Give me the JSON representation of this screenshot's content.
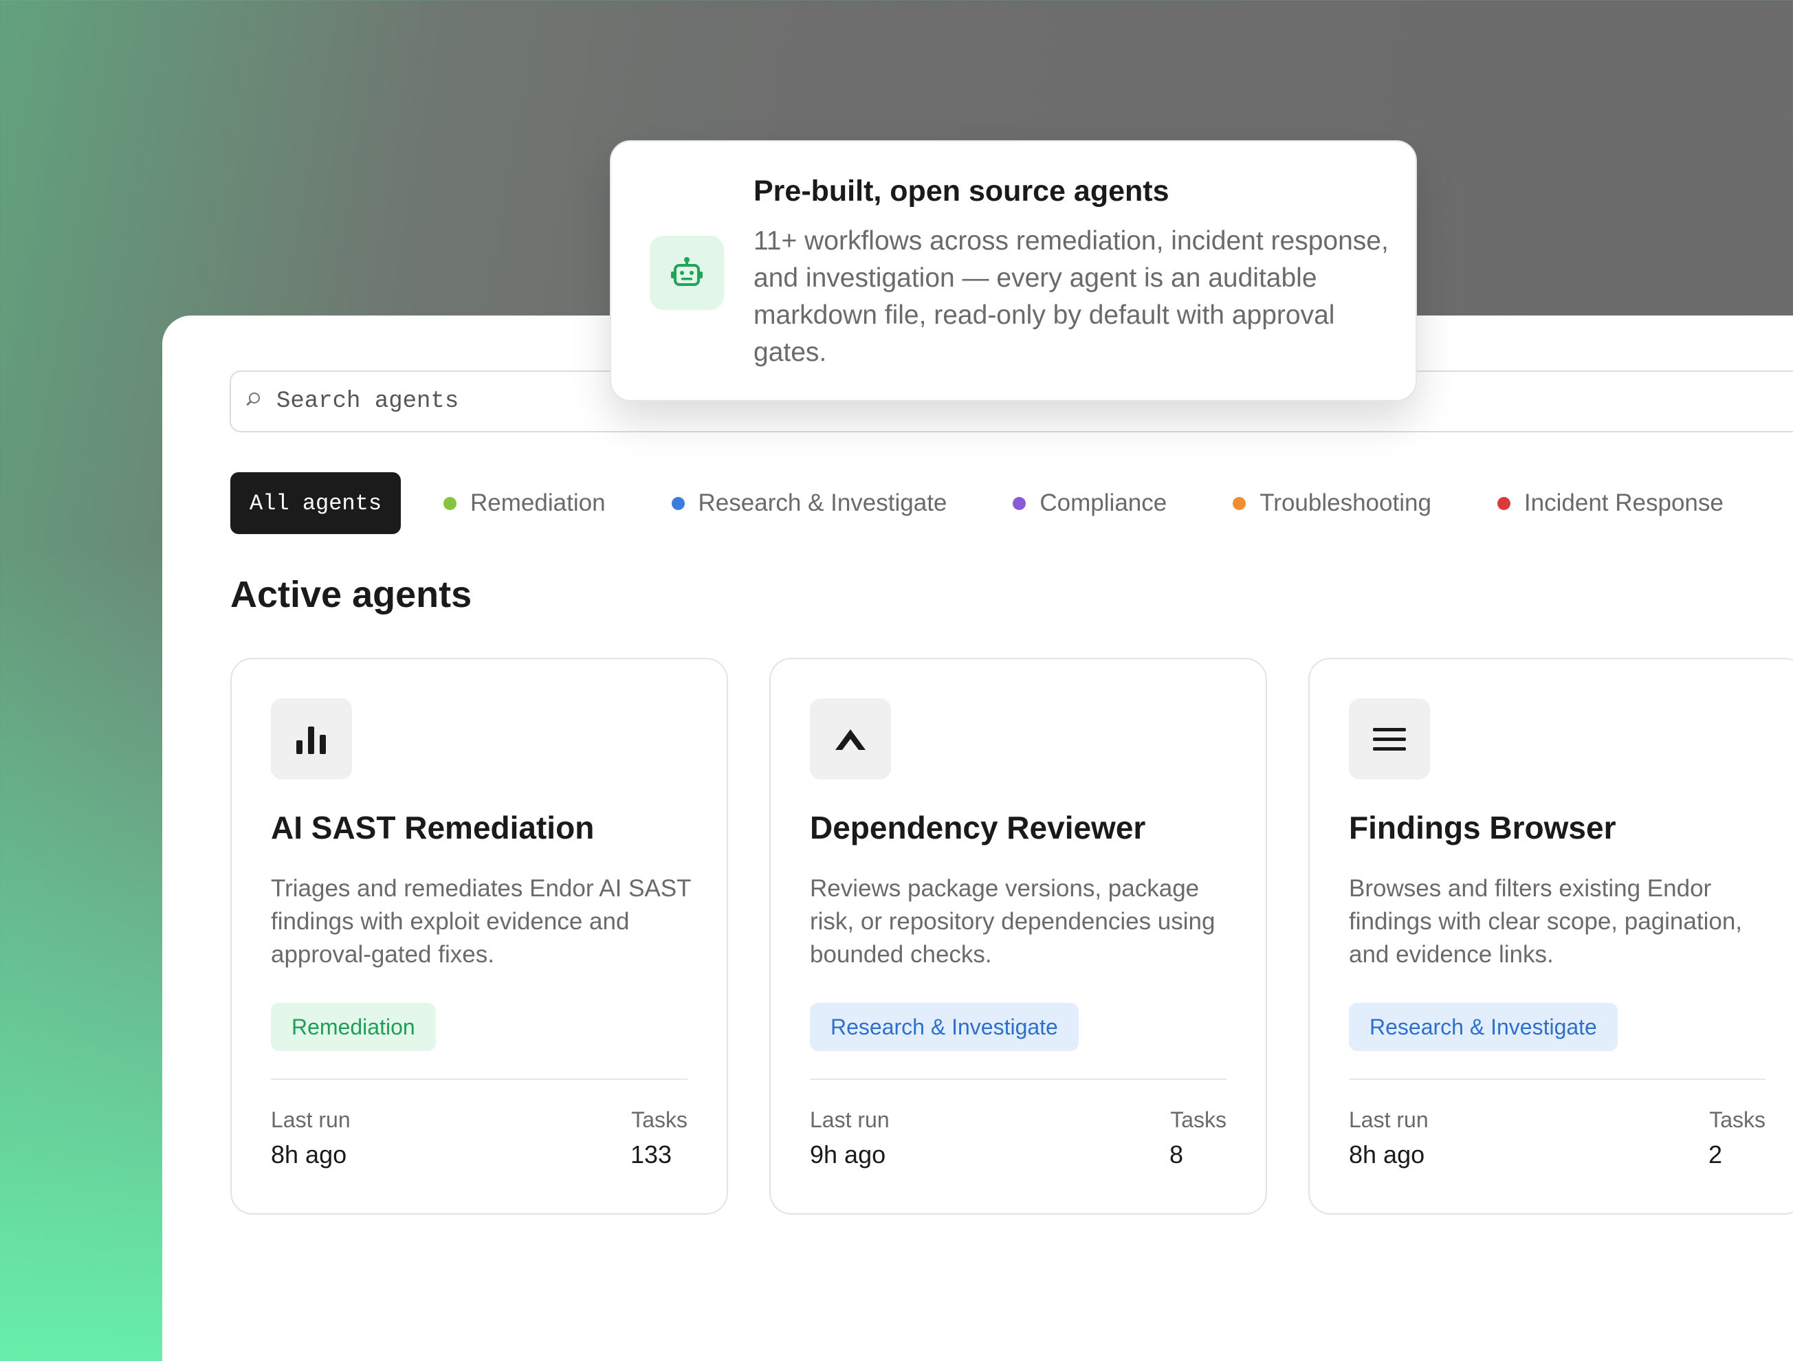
{
  "search": {
    "placeholder": "Search agents"
  },
  "filters": {
    "all_label": "All agents",
    "items": [
      {
        "label": "Remediation",
        "color": "#86c440"
      },
      {
        "label": "Research & Investigate",
        "color": "#3b7ddd"
      },
      {
        "label": "Compliance",
        "color": "#8a5bd8"
      },
      {
        "label": "Troubleshooting",
        "color": "#ef8f32"
      },
      {
        "label": "Incident Response",
        "color": "#d93a3a"
      }
    ]
  },
  "section": {
    "title": "Active agents"
  },
  "cards": [
    {
      "icon": "bar-chart-icon",
      "title": "AI SAST Remediation",
      "description": "Triages and remediates Endor AI SAST findings with exploit evidence and approval-gated fixes.",
      "tag": "Remediation",
      "last_run_label": "Last run",
      "last_run_value": "8h ago",
      "tasks_label": "Tasks",
      "tasks_value": "133"
    },
    {
      "icon": "caret-up-icon",
      "title": "Dependency Reviewer",
      "description": "Reviews package versions, package risk, or repository dependencies using bounded checks.",
      "tag": "Research & Investigate",
      "last_run_label": "Last run",
      "last_run_value": "9h ago",
      "tasks_label": "Tasks",
      "tasks_value": "8"
    },
    {
      "icon": "menu-icon",
      "title": "Findings Browser",
      "description": "Browses and filters existing Endor findings with clear scope, pagination, and evidence links.",
      "tag": "Research & Investigate",
      "last_run_label": "Last run",
      "last_run_value": "8h ago",
      "tasks_label": "Tasks",
      "tasks_value": "2"
    }
  ],
  "tooltip": {
    "icon": "robot-icon",
    "title": "Pre-built, open source agents",
    "body": "11+ workflows across remediation, incident response, and investigation — every agent is an auditable markdown file, read-only by default with approval gates."
  }
}
